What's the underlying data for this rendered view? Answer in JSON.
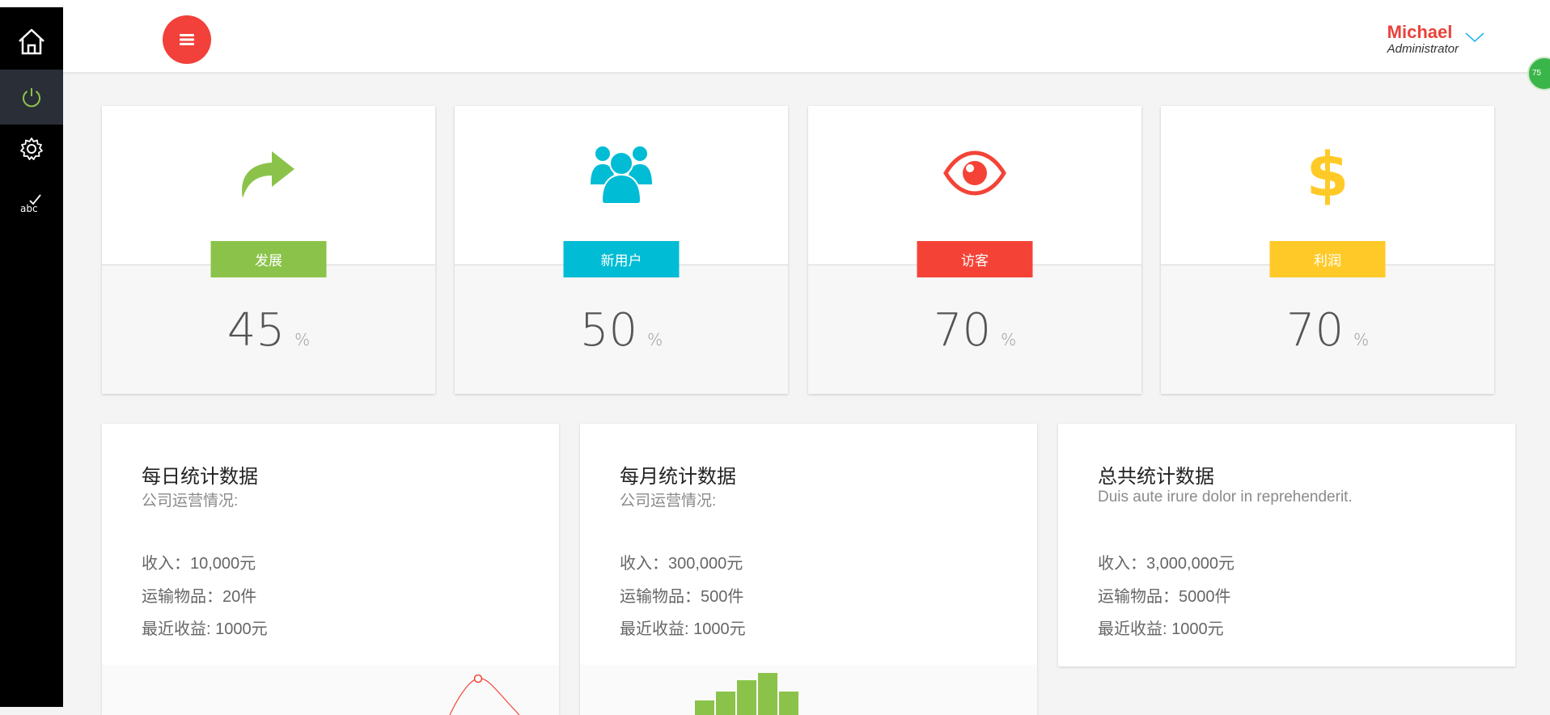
{
  "sidebar": {
    "items": [
      {
        "name": "home",
        "icon": "home-icon"
      },
      {
        "name": "power",
        "icon": "power-icon",
        "active": true
      },
      {
        "name": "settings",
        "icon": "gear-icon"
      },
      {
        "name": "spellcheck",
        "icon": "spellcheck-icon"
      }
    ]
  },
  "header": {
    "user_name": "Michael",
    "user_role": "Administrator",
    "badge": "75"
  },
  "stats": [
    {
      "label": "发展",
      "value": "45",
      "unit": "%",
      "color": "#8bc34a",
      "icon": "share-icon"
    },
    {
      "label": "新用户",
      "value": "50",
      "unit": "%",
      "color": "#00bcd4",
      "icon": "users-icon"
    },
    {
      "label": "访客",
      "value": "70",
      "unit": "%",
      "color": "#f44336",
      "icon": "eye-icon"
    },
    {
      "label": "利润",
      "value": "70",
      "unit": "%",
      "color": "#ffca28",
      "icon": "dollar-icon"
    }
  ],
  "panels": [
    {
      "title": "每日统计数据",
      "subtitle": "公司运营情况:",
      "lines": [
        "收入：10,000元",
        "运输物品：20件",
        "最近收益: 1000元"
      ]
    },
    {
      "title": "每月统计数据",
      "subtitle": "公司运营情况:",
      "lines": [
        "收入：300,000元",
        "运输物品：500件",
        "最近收益: 1000元"
      ]
    },
    {
      "title": "总共统计数据",
      "subtitle": "Duis aute irure dolor in reprehenderit.",
      "lines": [
        "收入：3,000,000元",
        "运输物品：5000件",
        "最近收益: 1000元"
      ]
    }
  ],
  "colors": {
    "accent": "#f2403a",
    "sidebar_bg": "#000000",
    "sidebar_active_bg": "#2a2e37",
    "power_icon": "#8bc34a"
  }
}
